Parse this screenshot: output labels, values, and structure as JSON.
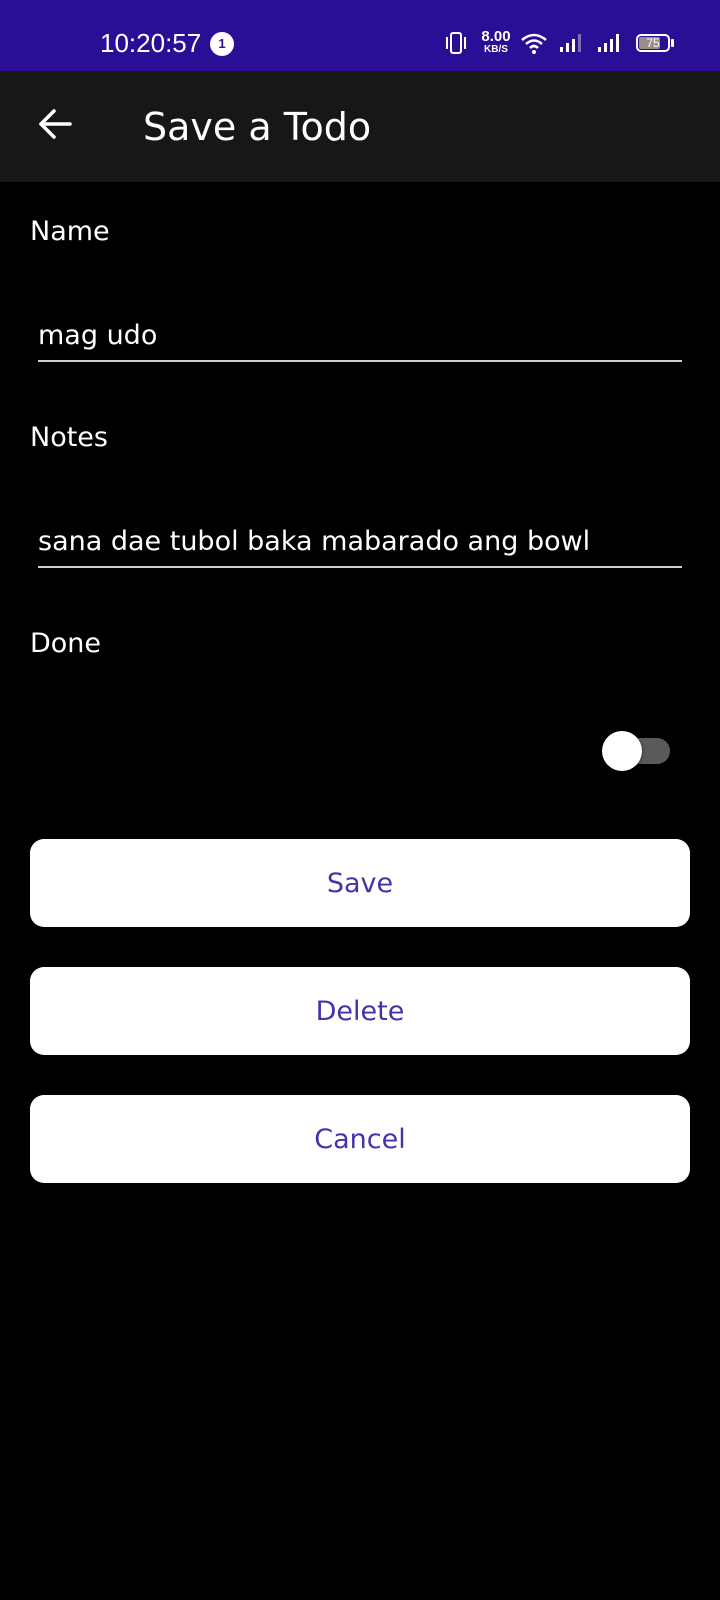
{
  "status_bar": {
    "time": "10:20:57",
    "notification_count": "1",
    "net_speed_value": "8.00",
    "net_speed_unit": "KB/S",
    "battery_level": "75",
    "battery_fraction": 0.75,
    "background_color": "#2a0e96"
  },
  "app_bar": {
    "title": "Save a Todo",
    "back_icon": "arrow-back-icon"
  },
  "form": {
    "name_label": "Name",
    "name_value": "mag udo",
    "notes_label": "Notes",
    "notes_value": "sana dae tubol baka mabarado ang bowl",
    "done_label": "Done",
    "done_checked": false
  },
  "buttons": {
    "save_label": "Save",
    "delete_label": "Delete",
    "cancel_label": "Cancel",
    "text_color": "#4b31a8"
  }
}
